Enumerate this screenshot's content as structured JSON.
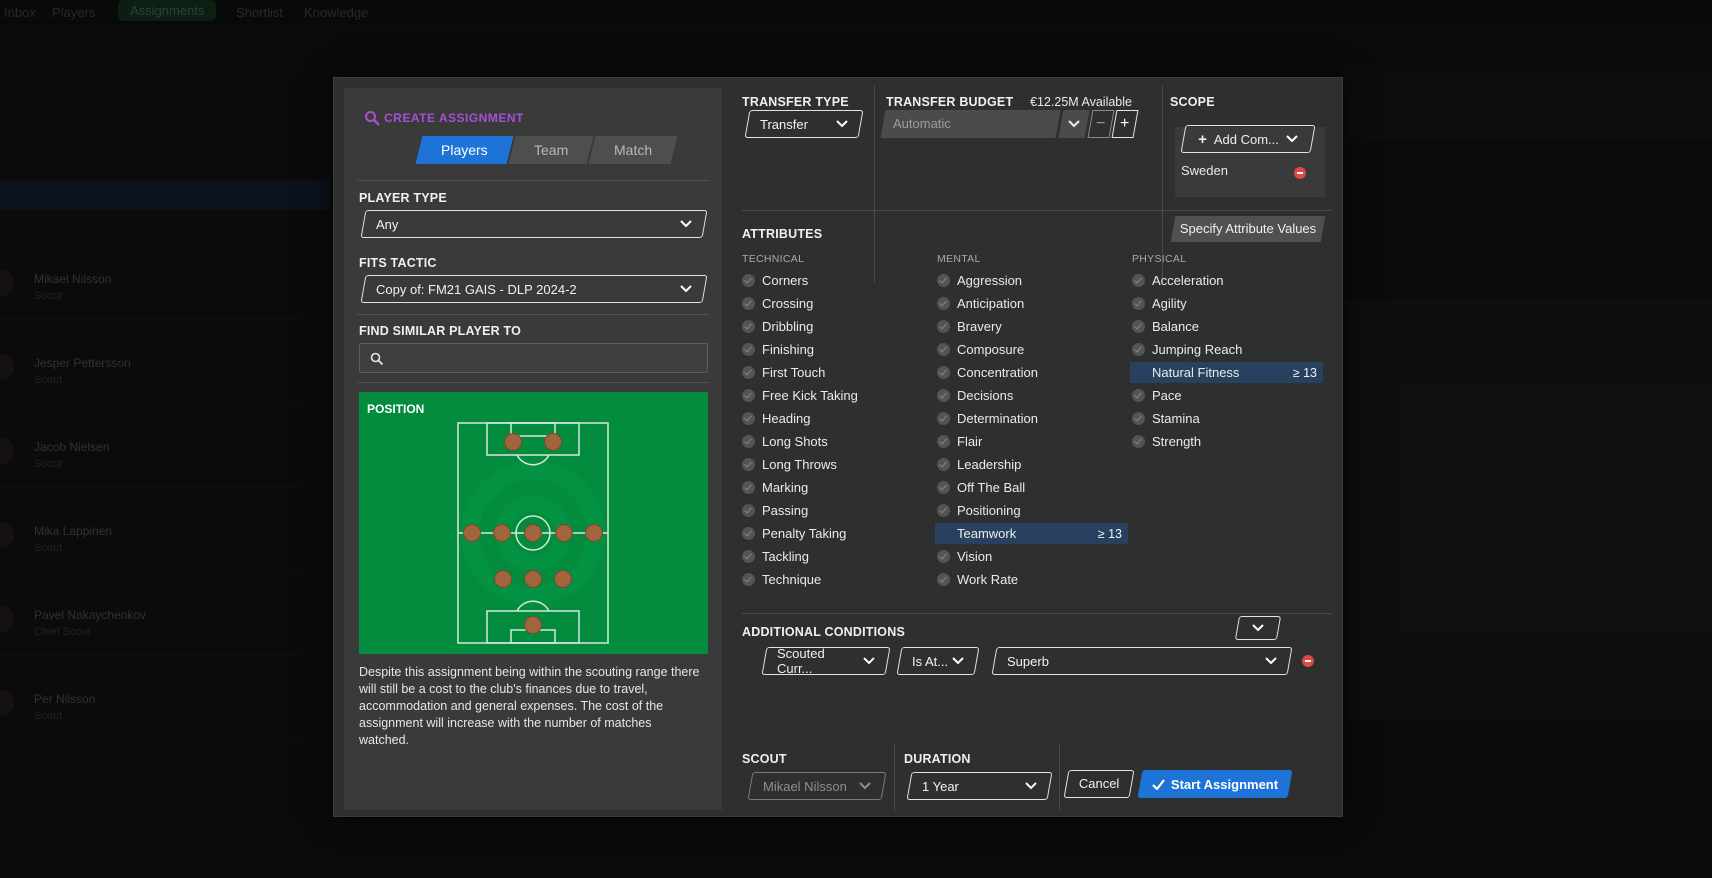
{
  "background": {
    "topnav": [
      "Inbox",
      "Players",
      "Assignments",
      "Shortlist",
      "Knowledge"
    ],
    "players": [
      {
        "name": "Mikael Nilsson",
        "role": "Scout"
      },
      {
        "name": "Jesper Pettersson",
        "role": "Scout"
      },
      {
        "name": "Jacob Nielsen",
        "role": "Scout"
      },
      {
        "name": "Mika Lappinen",
        "role": "Scout"
      },
      {
        "name": "Pavel Nakaychenkov",
        "role": "Chief Scout"
      },
      {
        "name": "Per Nilsson",
        "role": "Scout"
      }
    ]
  },
  "modal": {
    "title": "CREATE ASSIGNMENT",
    "tabs": [
      "Players",
      "Team",
      "Match"
    ],
    "active_tab": "Players",
    "player_type": {
      "label": "PLAYER TYPE",
      "value": "Any"
    },
    "fits_tactic": {
      "label": "FITS TACTIC",
      "value": "Copy of: FM21 GAIS - DLP 2024-2"
    },
    "find_similar": {
      "label": "FIND SIMILAR PLAYER TO",
      "value": ""
    },
    "position": {
      "label": "POSITION"
    },
    "description": "Despite this assignment being within the scouting range there will still be a cost to the club's finances due to travel, accommodation and general expenses. The cost of the assignment will increase with the number of matches watched.",
    "transfer_type": {
      "label": "TRANSFER TYPE",
      "value": "Transfer"
    },
    "transfer_budget": {
      "label": "TRANSFER BUDGET",
      "available": "€12.25M Available",
      "value": "Automatic",
      "minus": "−",
      "plus": "+"
    },
    "scope": {
      "label": "SCOPE",
      "add_button": "Add Com...",
      "items": [
        "Sweden"
      ]
    },
    "attributes": {
      "label": "ATTRIBUTES",
      "specify_button": "Specify Attribute Values",
      "technical": {
        "label": "TECHNICAL",
        "items": [
          "Corners",
          "Crossing",
          "Dribbling",
          "Finishing",
          "First Touch",
          "Free Kick Taking",
          "Heading",
          "Long Shots",
          "Long Throws",
          "Marking",
          "Passing",
          "Penalty Taking",
          "Tackling",
          "Technique"
        ]
      },
      "mental": {
        "label": "MENTAL",
        "items": [
          "Aggression",
          "Anticipation",
          "Bravery",
          "Composure",
          "Concentration",
          "Decisions",
          "Determination",
          "Flair",
          "Leadership",
          "Off The Ball",
          "Positioning",
          "Teamwork",
          "Vision",
          "Work Rate"
        ],
        "selected": {
          "name": "Teamwork",
          "value": "≥ 13"
        }
      },
      "physical": {
        "label": "PHYSICAL",
        "items": [
          "Acceleration",
          "Agility",
          "Balance",
          "Jumping Reach",
          "Natural Fitness",
          "Pace",
          "Stamina",
          "Strength"
        ],
        "selected": {
          "name": "Natural Fitness",
          "value": "≥ 13"
        }
      }
    },
    "conditions": {
      "label": "ADDITIONAL CONDITIONS",
      "field": "Scouted Curr...",
      "operator": "Is At...",
      "value": "Superb"
    },
    "scout": {
      "label": "SCOUT",
      "value": "Mikael Nilsson"
    },
    "duration": {
      "label": "DURATION",
      "value": "1 Year"
    },
    "cancel": "Cancel",
    "start": "Start Assignment"
  },
  "colors": {
    "accent": "#1d74d6",
    "title_purple": "#a64fd7",
    "pitch_green": "#038c3e",
    "remove_red": "#e04747"
  }
}
